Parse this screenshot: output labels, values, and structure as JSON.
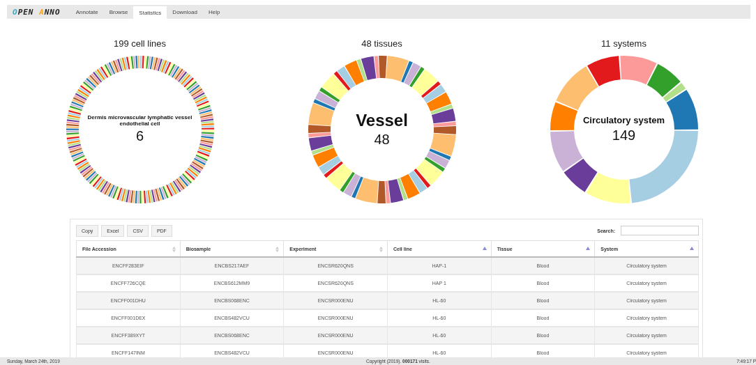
{
  "nav": {
    "logo": [
      {
        "text": "O",
        "color": "#3aa8c1"
      },
      {
        "text": "PEN ",
        "color": "#222222"
      },
      {
        "text": "A",
        "color": "#f5a623"
      },
      {
        "text": "NNO",
        "color": "#222222"
      }
    ],
    "tabs": [
      {
        "label": "Annotate",
        "selected": false
      },
      {
        "label": "Browse",
        "selected": false
      },
      {
        "label": "Statistics",
        "selected": true
      },
      {
        "label": "Download",
        "selected": false
      },
      {
        "label": "Help",
        "selected": false
      }
    ]
  },
  "charts": [
    {
      "title": "199 cell lines",
      "kind": "many",
      "center_label": "Dermis microvascular lymphatic vessel endothelial cell",
      "center_value": "6"
    },
    {
      "title": "48 tissues",
      "kind": "medium",
      "center_label": "Vessel",
      "center_value": "48"
    },
    {
      "title": "11 systems",
      "kind": "few",
      "center_label": "Circulatory system",
      "center_value": "149"
    }
  ],
  "table": {
    "buttons": [
      "Copy",
      "Excel",
      "CSV",
      "PDF"
    ],
    "search": {
      "label": "Search:"
    },
    "columns": [
      {
        "label": "File Accession",
        "sorted": false
      },
      {
        "label": "Biosample",
        "sorted": false
      },
      {
        "label": "Experiment",
        "sorted": false
      },
      {
        "label": "Cell line",
        "sorted": true
      },
      {
        "label": "Tissue",
        "sorted": true
      },
      {
        "label": "System",
        "sorted": true
      }
    ],
    "rows": [
      [
        "ENCFF283EIF",
        "ENCBS217AEF",
        "ENCSR620QNS",
        "HAP-1",
        "Blood",
        "Circulatory system"
      ],
      [
        "ENCFF726CQE",
        "ENCBS612MM9",
        "ENCSR620QNS",
        "HAP 1",
        "Blood",
        "Circulatory system"
      ],
      [
        "ENCFF001DHU",
        "ENCBS068ENC",
        "ENCSR000ENU",
        "HL-60",
        "Blood",
        "Circulatory system"
      ],
      [
        "ENCFF001DEX",
        "ENCBS482VCU",
        "ENCSR000ENU",
        "HL-60",
        "Blood",
        "Circulatory system"
      ],
      [
        "ENCFF389XYT",
        "ENCBS068ENC",
        "ENCSR000ENU",
        "HL-60",
        "Blood",
        "Circulatory system"
      ],
      [
        "ENCFF147INM",
        "ENCBS482VCU",
        "ENCSR000ENU",
        "HL-60",
        "Blood",
        "Circulatory system"
      ]
    ]
  },
  "footer": {
    "date": "Sunday, March 24th, 2019",
    "copyright": "Copyright (2019). **000171** visits.",
    "time": "7:49:17 P"
  }
}
